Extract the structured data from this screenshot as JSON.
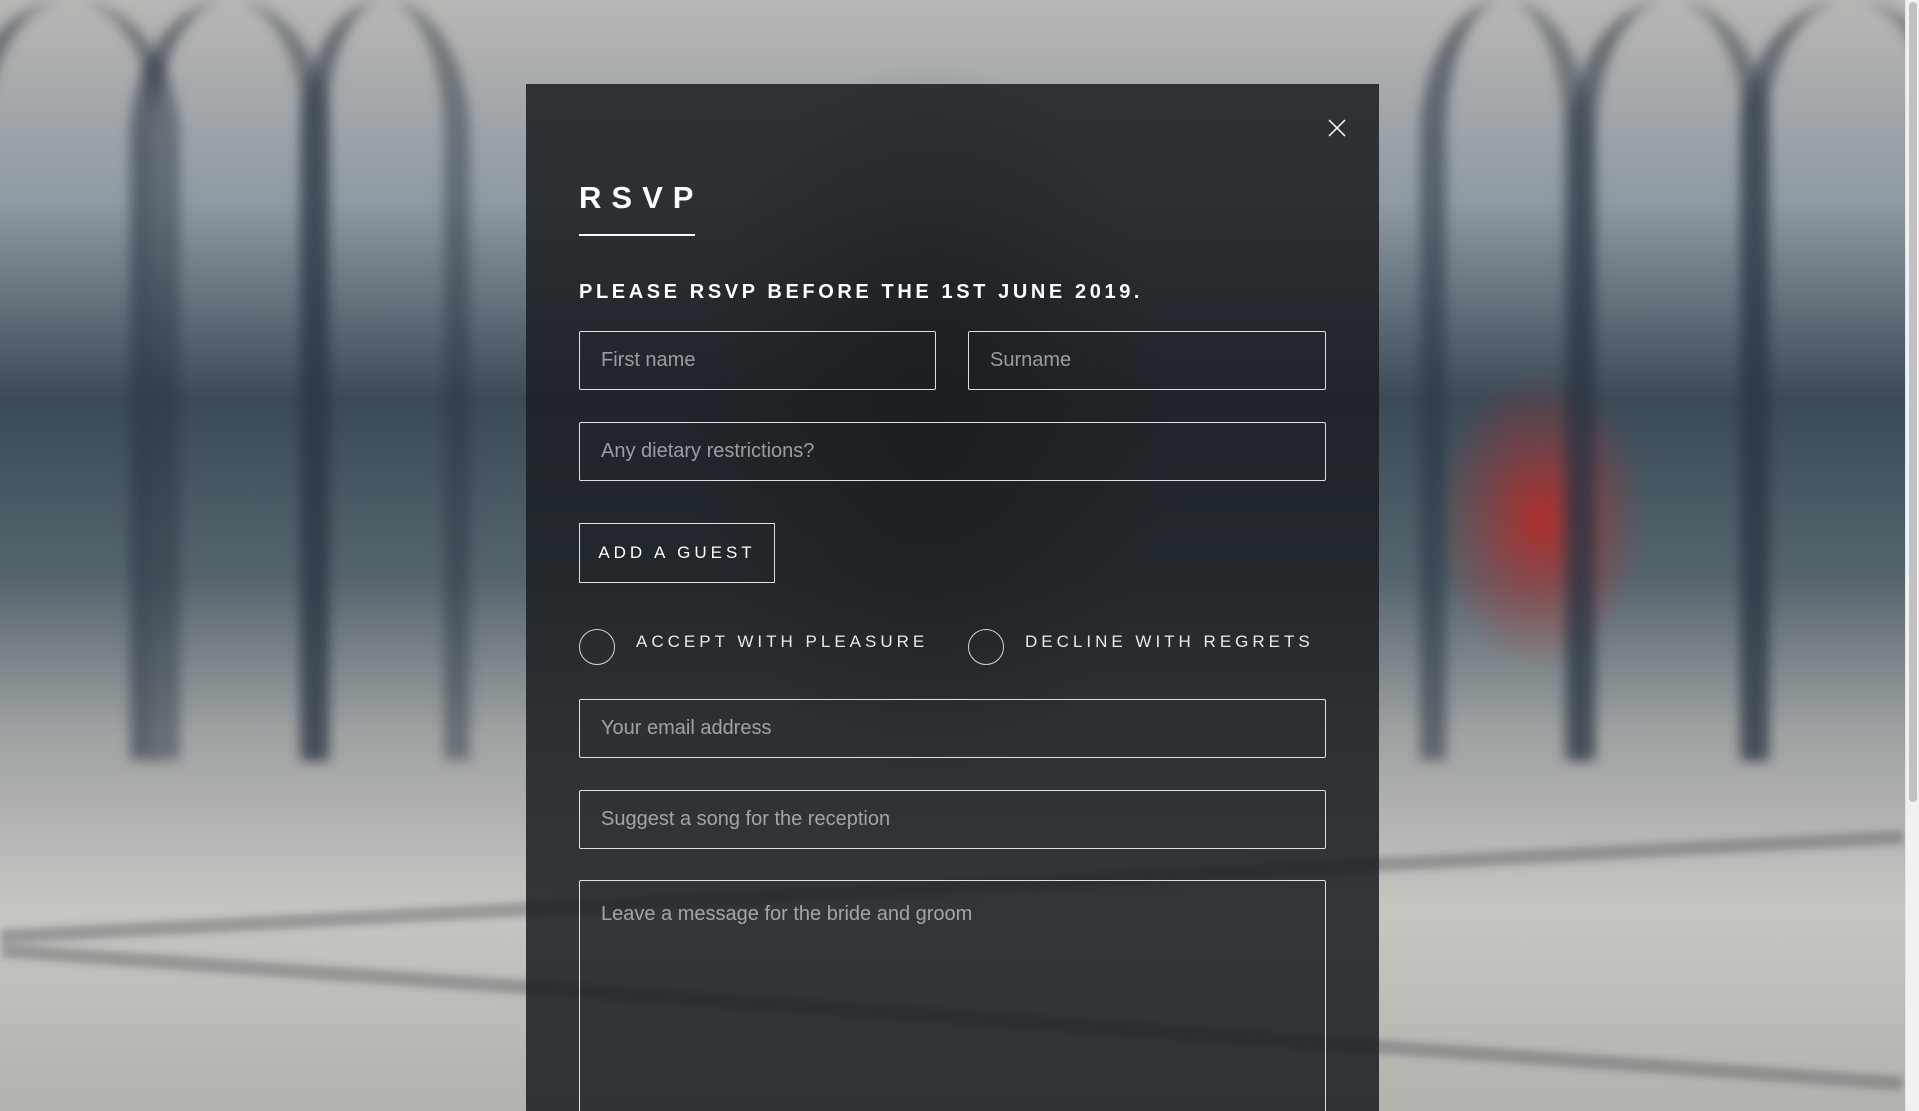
{
  "modal": {
    "close_icon": "close-icon",
    "title": "RSVP",
    "deadline": "PLEASE RSVP BEFORE THE 1ST JUNE 2019.",
    "fields": {
      "first_name": {
        "value": "",
        "placeholder": "First name"
      },
      "surname": {
        "value": "",
        "placeholder": "Surname"
      },
      "dietary": {
        "value": "",
        "placeholder": "Any dietary restrictions?"
      },
      "email": {
        "value": "",
        "placeholder": "Your email address"
      },
      "song": {
        "value": "",
        "placeholder": "Suggest a song for the reception"
      },
      "message": {
        "value": "",
        "placeholder": "Leave a message for the bride and groom"
      }
    },
    "add_guest_label": "ADD A GUEST",
    "options": {
      "accept": {
        "label": "ACCEPT WITH PLEASURE",
        "selected": false
      },
      "decline": {
        "label": "DECLINE WITH REGRETS",
        "selected": false
      }
    }
  },
  "colors": {
    "modal_background": "#1a1e22",
    "text": "#ffffff",
    "accent_red": "#be2823"
  }
}
